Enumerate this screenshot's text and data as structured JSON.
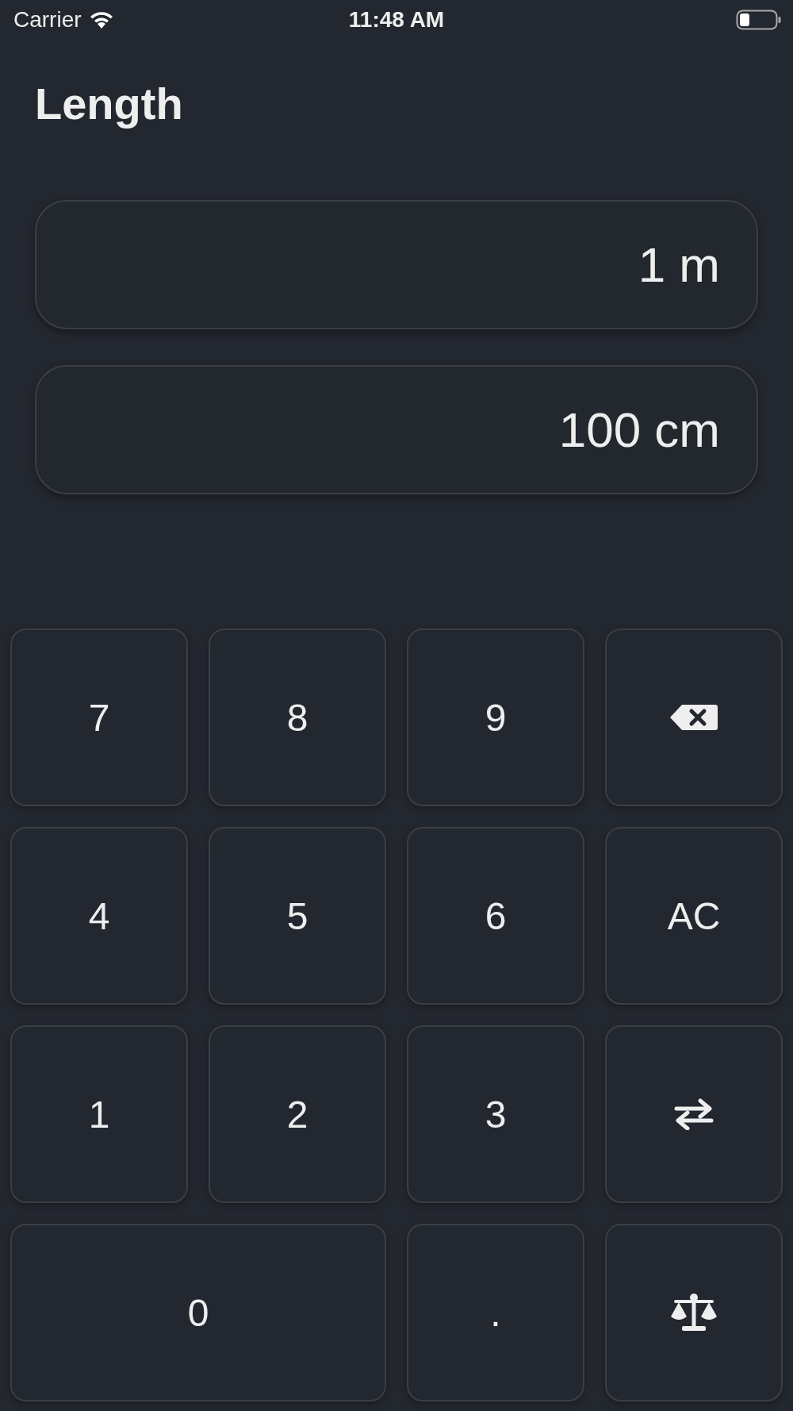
{
  "status_bar": {
    "carrier": "Carrier",
    "time": "11:48 AM"
  },
  "title": "Length",
  "displays": [
    {
      "value": "1 m"
    },
    {
      "value": "100 cm"
    }
  ],
  "keys": [
    {
      "kind": "digit",
      "label": "7"
    },
    {
      "kind": "digit",
      "label": "8"
    },
    {
      "kind": "digit",
      "label": "9"
    },
    {
      "kind": "backspace"
    },
    {
      "kind": "digit",
      "label": "4"
    },
    {
      "kind": "digit",
      "label": "5"
    },
    {
      "kind": "digit",
      "label": "6"
    },
    {
      "kind": "digit",
      "label": "AC"
    },
    {
      "kind": "digit",
      "label": "1"
    },
    {
      "kind": "digit",
      "label": "2"
    },
    {
      "kind": "digit",
      "label": "3"
    },
    {
      "kind": "swap"
    },
    {
      "kind": "wide",
      "label": "0"
    },
    {
      "kind": "digit",
      "label": "."
    },
    {
      "kind": "scale"
    }
  ]
}
